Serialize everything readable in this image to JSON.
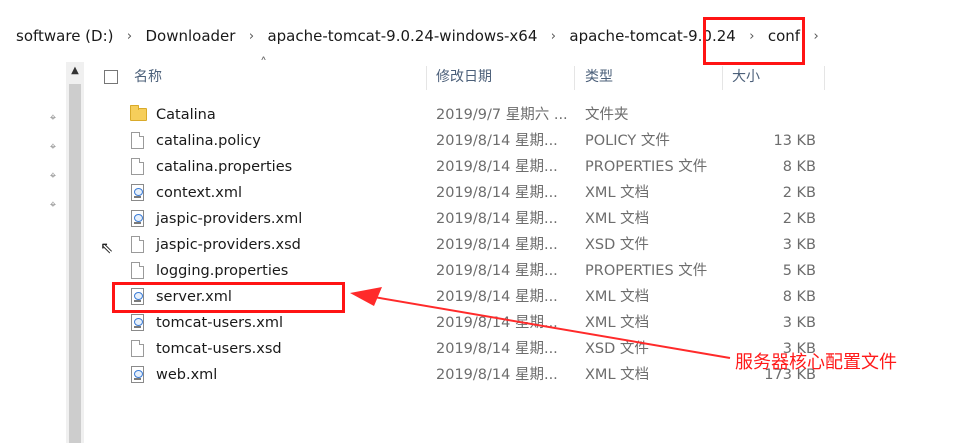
{
  "breadcrumb": {
    "items": [
      "software (D:)",
      "Downloader",
      "apache-tomcat-9.0.24-windows-x64",
      "apache-tomcat-9.0.24",
      "conf"
    ]
  },
  "columns": {
    "name": "名称",
    "date": "修改日期",
    "type": "类型",
    "size": "大小"
  },
  "files": [
    {
      "name": "Catalina",
      "date": "2019/9/7 星期六 ...",
      "type": "文件夹",
      "size": "",
      "icon": "folder-icon"
    },
    {
      "name": "catalina.policy",
      "date": "2019/8/14 星期...",
      "type": "POLICY 文件",
      "size": "13 KB",
      "icon": "file-icon"
    },
    {
      "name": "catalina.properties",
      "date": "2019/8/14 星期...",
      "type": "PROPERTIES 文件",
      "size": "8 KB",
      "icon": "file-icon"
    },
    {
      "name": "context.xml",
      "date": "2019/8/14 星期...",
      "type": "XML 文档",
      "size": "2 KB",
      "icon": "xml-file-icon"
    },
    {
      "name": "jaspic-providers.xml",
      "date": "2019/8/14 星期...",
      "type": "XML 文档",
      "size": "2 KB",
      "icon": "xml-file-icon"
    },
    {
      "name": "jaspic-providers.xsd",
      "date": "2019/8/14 星期...",
      "type": "XSD 文件",
      "size": "3 KB",
      "icon": "file-icon"
    },
    {
      "name": "logging.properties",
      "date": "2019/8/14 星期...",
      "type": "PROPERTIES 文件",
      "size": "5 KB",
      "icon": "file-icon"
    },
    {
      "name": "server.xml",
      "date": "2019/8/14 星期...",
      "type": "XML 文档",
      "size": "8 KB",
      "icon": "xml-file-icon"
    },
    {
      "name": "tomcat-users.xml",
      "date": "2019/8/14 星期...",
      "type": "XML 文档",
      "size": "3 KB",
      "icon": "xml-file-icon"
    },
    {
      "name": "tomcat-users.xsd",
      "date": "2019/8/14 星期...",
      "type": "XSD 文件",
      "size": "3 KB",
      "icon": "file-icon"
    },
    {
      "name": "web.xml",
      "date": "2019/8/14 星期...",
      "type": "XML 文档",
      "size": "173 KB",
      "icon": "xml-file-icon"
    }
  ],
  "annotation": {
    "text": "服务器核心配置文件",
    "color": "#ff1414"
  },
  "icons": {
    "pin": "pin-icon",
    "sort": "sort-up-icon",
    "scroll_up": "scroll-up-icon",
    "cursor": "mouse-cursor-icon"
  }
}
